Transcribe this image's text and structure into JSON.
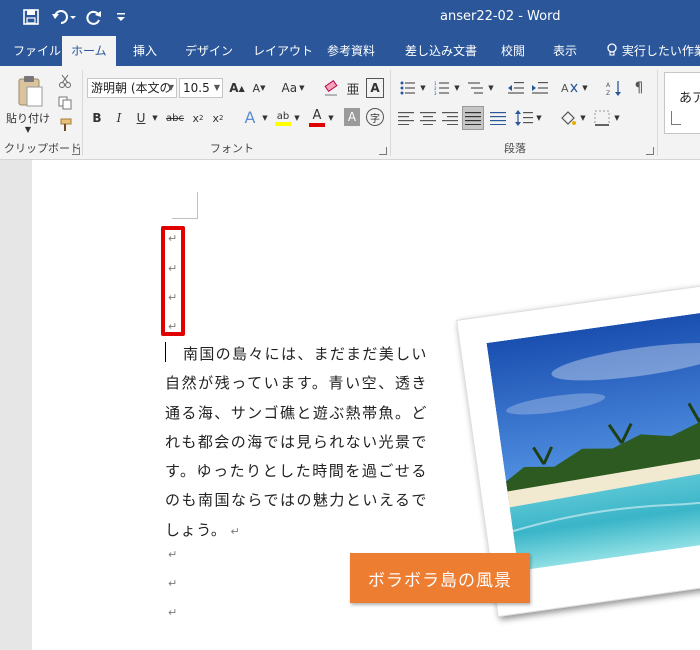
{
  "titlebar": {
    "title": "anser22-02  -  Word"
  },
  "tabs": [
    "ファイル",
    "ホーム",
    "挿入",
    "デザイン",
    "レイアウト",
    "参考資料",
    "差し込み文書",
    "校閲",
    "表示"
  ],
  "tell_me": "実行したい作業",
  "ribbon": {
    "clipboard": {
      "paste_label": "貼り付け",
      "group_label": "クリップボード"
    },
    "font": {
      "font_name": "游明朝 (本文の",
      "font_size": "10.5",
      "case_label": "Aa",
      "group_label": "フォント"
    },
    "paragraph": {
      "group_label": "段落"
    },
    "styles": {
      "preview": "あア"
    }
  },
  "document": {
    "paragraph_mark": "↵",
    "body": "南国の島々には、まだまだ美しい自然が残っています。青い空、透き通る海、サンゴ礁と遊ぶ熱帯魚。どれも都会の海では見られない光景です。ゆったりとした時間を過ごせるのも南国ならではの魅力といえるでしょう。",
    "caption": "ボラボラ島の風景"
  },
  "colors": {
    "accent": "#2b579a",
    "highlight": "#e00000",
    "caption_bg": "#ed7d31"
  }
}
